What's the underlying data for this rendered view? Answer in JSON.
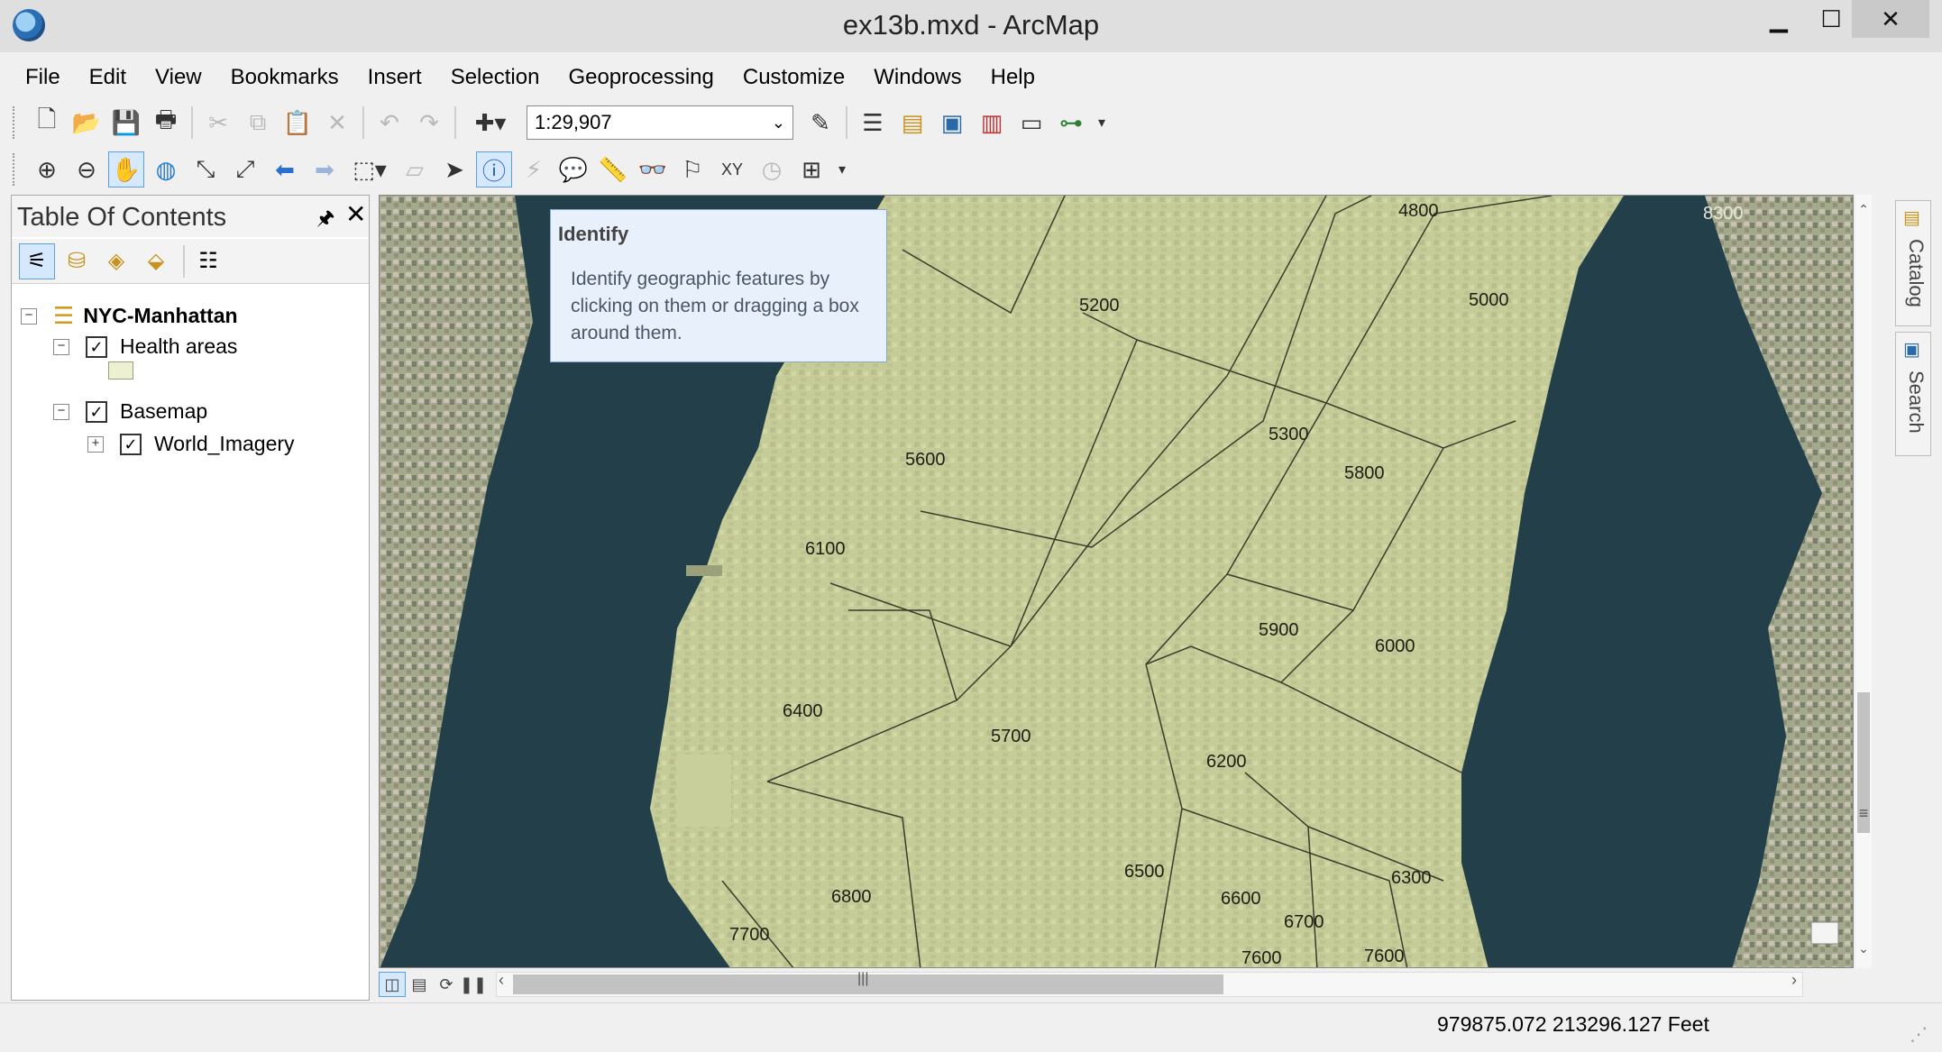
{
  "window": {
    "title": "ex13b.mxd - ArcMap",
    "minimize_symbol": "▁",
    "maximize_symbol": "☐",
    "close_symbol": "✕"
  },
  "menu": [
    "File",
    "Edit",
    "View",
    "Bookmarks",
    "Insert",
    "Selection",
    "Geoprocessing",
    "Customize",
    "Windows",
    "Help"
  ],
  "standard_toolbar": {
    "scale": "1:29,907",
    "icons": [
      "new-document-icon",
      "open-folder-icon",
      "save-icon",
      "print-icon",
      "cut-icon",
      "copy-icon",
      "paste-icon",
      "delete-icon",
      "undo-icon",
      "redo-icon",
      "add-data-icon",
      "editor-toolbar-icon",
      "table-of-contents-icon",
      "catalog-window-icon",
      "search-window-icon",
      "arctoolbox-icon",
      "python-window-icon",
      "model-builder-icon"
    ]
  },
  "tools_toolbar": {
    "icons": [
      "zoom-in-icon",
      "zoom-out-icon",
      "pan-icon",
      "full-extent-icon",
      "fixed-zoom-in-icon",
      "fixed-zoom-out-icon",
      "back-icon",
      "forward-icon",
      "select-features-icon",
      "clear-selection-icon",
      "select-elements-icon",
      "identify-icon",
      "hyperlink-icon",
      "html-popup-icon",
      "measure-icon",
      "find-icon",
      "find-route-icon",
      "go-to-xy-icon",
      "time-slider-icon",
      "magnifier-window-icon"
    ]
  },
  "toc": {
    "title": "Table Of Contents",
    "pin_symbol": "🖈",
    "close_symbol": "✕",
    "tools": [
      "list-by-drawing-order-icon",
      "list-by-source-icon",
      "list-by-visibility-icon",
      "list-by-selection-icon",
      "options-icon"
    ],
    "tree": {
      "frame": "NYC-Manhattan",
      "layer1": "Health areas",
      "group": "Basemap",
      "layer2": "World_Imagery",
      "expanded": "−",
      "collapsed": "+",
      "checked": "✓"
    }
  },
  "tooltip": {
    "title": "Identify",
    "body": "Identify geographic features by clicking on them or dragging a box around them."
  },
  "map_labels": [
    "4800",
    "5200",
    "5000",
    "5300",
    "5600",
    "5800",
    "6100",
    "5900",
    "6000",
    "6400",
    "5700",
    "6200",
    "6500",
    "6600",
    "6300",
    "6800",
    "6700",
    "7700",
    "7600",
    "7600",
    "8300"
  ],
  "side_dock": {
    "catalog": "Catalog",
    "search": "Search"
  },
  "status": {
    "coordinates": "979875.072  213296.127 Feet"
  },
  "colors": {
    "water": "#23404a",
    "land_overlay": "#c9cf9a",
    "selection_blue": "#d6e8fb"
  }
}
